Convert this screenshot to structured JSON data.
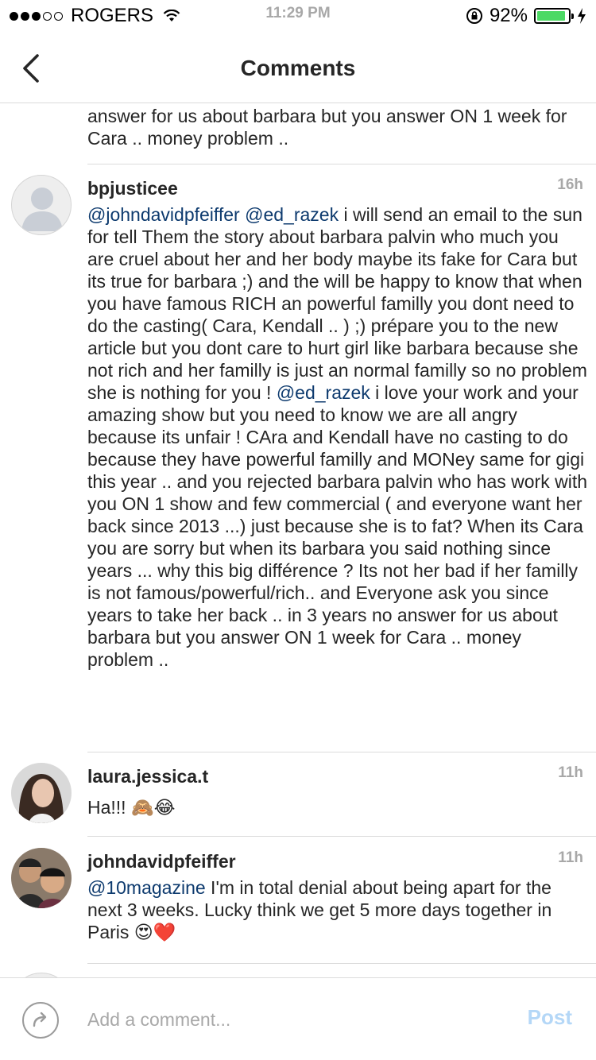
{
  "status": {
    "carrier": "ROGERS",
    "time": "11:29 PM",
    "battery": "92%",
    "battery_level": 0.92
  },
  "nav": {
    "title": "Comments"
  },
  "partial_comment": {
    "text": "answer  for us about barbara but you answer ON 1 week for Cara .. money problem .."
  },
  "comments": [
    {
      "username": "bpjusticee",
      "time": "16h",
      "mention1": "@johndavidpfeiffer",
      "mention2": "@ed_razek",
      "text_a": " i will send an email to the sun for tell Them the story about barbara palvin who much you are cruel about her and her body maybe its fake for Cara but its true for barbara ;) and the will be happy to know that when you have famous RICH an powerful familly you dont need to do the casting( Cara, Kendall .. ) ;) prépare you to the new article but you dont care to hurt girl like barbara because she not rich and her familly is just an normal familly so no problem she is nothing for you ! ",
      "mention3": "@ed_razek",
      "text_b": " i love your work and your amazing show but you need to know we are all angry because its unfair !  CAra and Kendall have no casting to do because they have powerful familly and MONey same for gigi this year .. and you rejected barbara palvin who has work with you ON 1 show and few commercial ( and everyone want her back since 2013 ...) just because she is to fat? When its Cara you are sorry but when its barbara you said nothing since years ... why this big différence ? Its not her bad if her familly is not famous/powerful/rich.. and Everyone ask you since years to take her back .. in 3 years no answer  for us about barbara but you answer ON 1 week for Cara .. money problem .."
    },
    {
      "username": "laura.jessica.t",
      "time": "11h",
      "text": "Ha!!! 🙈😂"
    },
    {
      "username": "johndavidpfeiffer",
      "time": "11h",
      "mention1": "@10magazine",
      "text": " I'm in total denial about being apart for the next 3 weeks. Lucky think we get 5 more days together in Paris 😍❤️"
    }
  ],
  "composer": {
    "placeholder": "Add a comment...",
    "post_label": "Post"
  }
}
